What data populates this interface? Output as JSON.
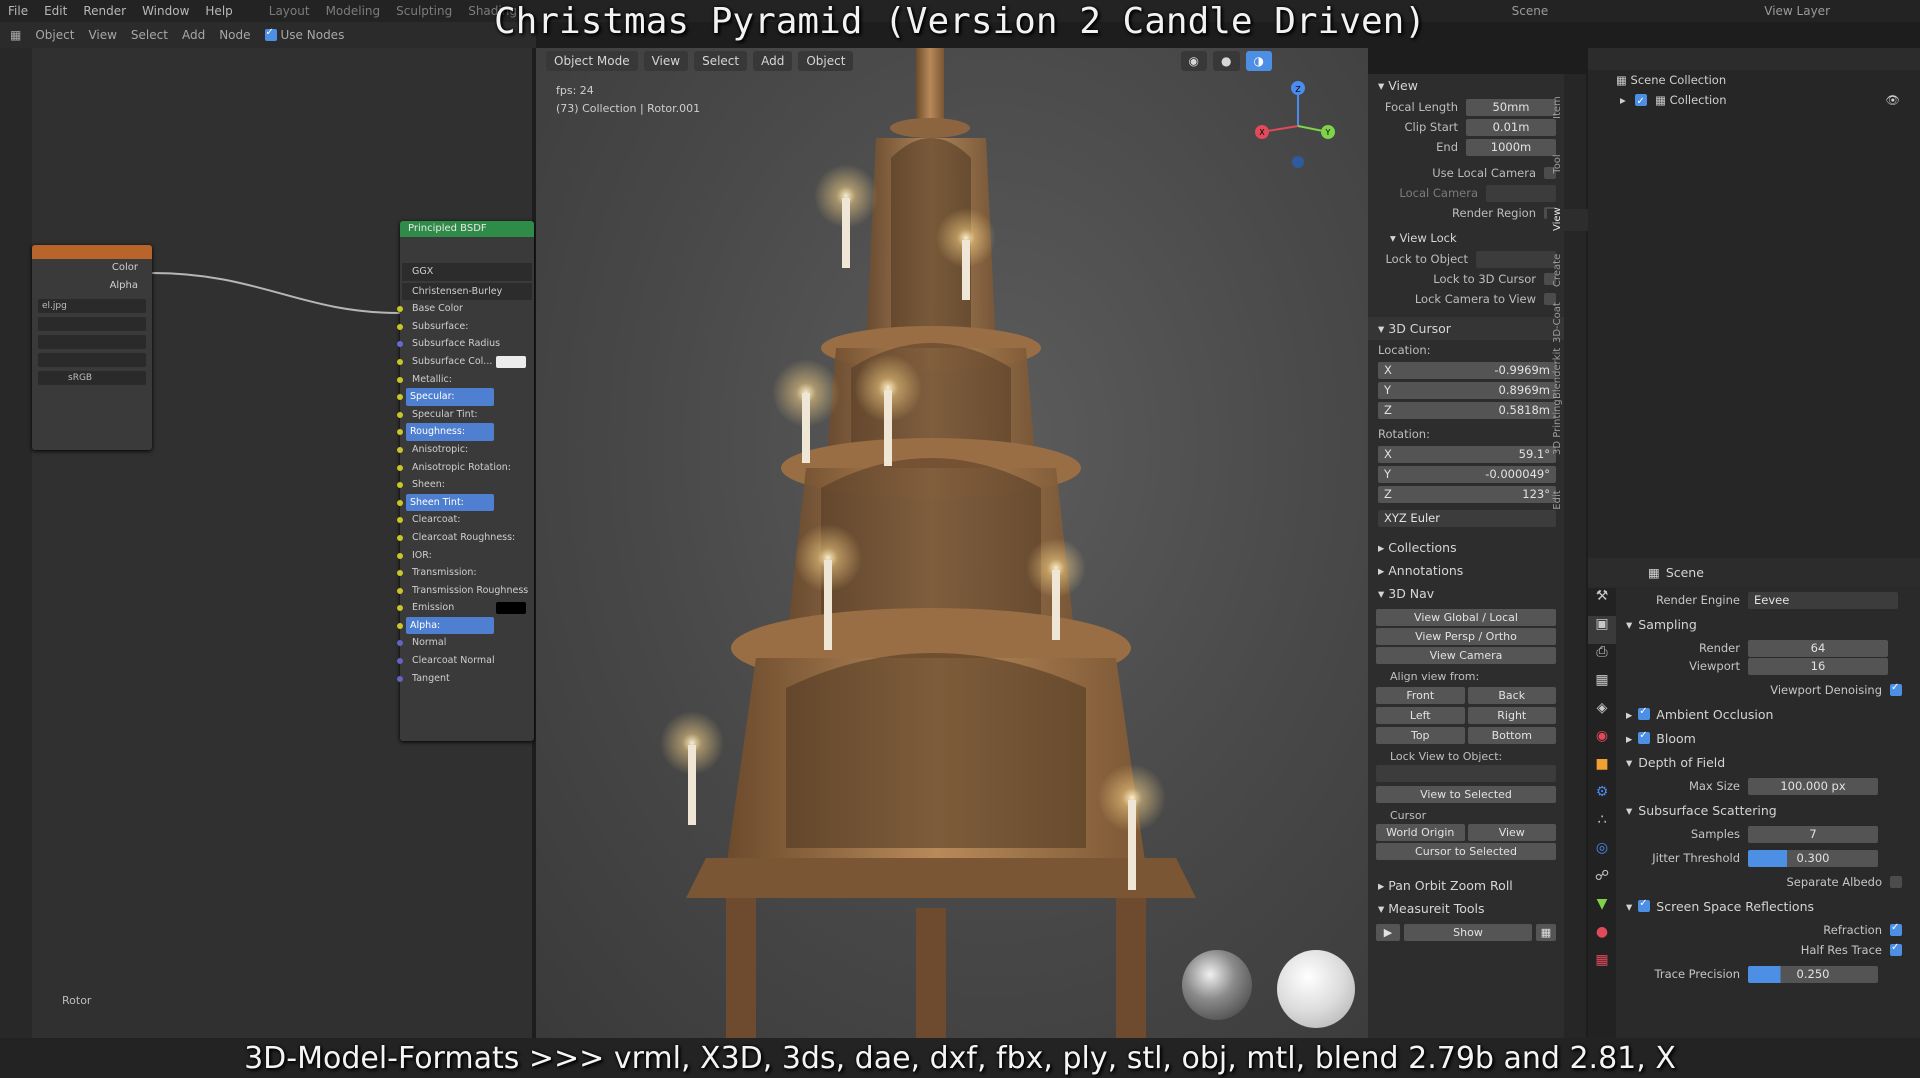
{
  "overlay": {
    "title": "Christmas Pyramid (Version 2 Candle Driven)",
    "footer": "3D-Model-Formats >>> vrml, X3D, 3ds, dae, dxf, fbx, ply, stl, obj, mtl, blend 2.79b and 2.81, X"
  },
  "menubar": {
    "items": [
      "File",
      "Edit",
      "Render",
      "Window",
      "Help"
    ],
    "workspaces": [
      "Layout",
      "Modeling",
      "Sculpting",
      "Shading"
    ],
    "scene": "Scene",
    "view_layer": "View Layer"
  },
  "node_editor": {
    "header": [
      "Object",
      "View",
      "Select",
      "Add",
      "Node",
      "Use Nodes"
    ],
    "texture_node": {
      "outputs": [
        "Color",
        "Alpha"
      ],
      "image": "el.jpg",
      "colorspace": "sRGB"
    },
    "bsdf": {
      "title": "Principled BSDF",
      "distribution": "GGX",
      "subsurface_method": "Christensen-Burley",
      "inputs": [
        "Base Color",
        "Subsurface:",
        "Subsurface Radius",
        "Subsurface Col...",
        "Metallic:",
        "Specular:",
        "Specular Tint:",
        "Roughness:",
        "Anisotropic:",
        "Anisotropic Rotation:",
        "Sheen:",
        "Sheen Tint:",
        "Clearcoat:",
        "Clearcoat Roughness:",
        "IOR:",
        "Transmission:",
        "Transmission Roughness",
        "Emission",
        "Alpha:",
        "Normal",
        "Clearcoat Normal",
        "Tangent"
      ],
      "highlighted": [
        "Specular:",
        "Roughness:",
        "Sheen Tint:",
        "Alpha:"
      ]
    },
    "frame_label": "Rotor"
  },
  "viewport": {
    "header": [
      "Object Mode",
      "View",
      "Select",
      "Add",
      "Object"
    ],
    "fps": "fps: 24",
    "info": "(73) Collection | Rotor.001",
    "gizmo": {
      "x": "X",
      "y": "Y",
      "z": "Z"
    }
  },
  "npanel": {
    "tabs": [
      "Item",
      "Tool",
      "View",
      "Create",
      "3D-Coat",
      "Blenderkit",
      "3D Printing",
      "Edit"
    ],
    "view": {
      "title": "View",
      "focal_length_label": "Focal Length",
      "focal_length": "50mm",
      "clip_start_label": "Clip Start",
      "clip_start": "0.01m",
      "end_label": "End",
      "end": "1000m",
      "use_local_camera": "Use Local Camera",
      "local_camera": "Local Camera",
      "render_region": "Render Region",
      "view_lock": "View Lock",
      "lock_to_object": "Lock to Object",
      "lock_3d_cursor": "Lock to 3D Cursor",
      "lock_camera": "Lock Camera to View"
    },
    "cursor": {
      "title": "3D Cursor",
      "location": "Location:",
      "loc": [
        [
          "X",
          "-0.9969m"
        ],
        [
          "Y",
          "0.8969m"
        ],
        [
          "Z",
          "0.5818m"
        ]
      ],
      "rotation": "Rotation:",
      "rot": [
        [
          "X",
          "59.1°"
        ],
        [
          "Y",
          "-0.000049°"
        ],
        [
          "Z",
          "123°"
        ]
      ],
      "mode": "XYZ Euler"
    },
    "collapsed": [
      "Collections",
      "Annotations"
    ],
    "nav": {
      "title": "3D Nav",
      "global_local": "View Global / Local",
      "persp_ortho": "View Persp / Ortho",
      "camera": "View Camera",
      "align": "Align view from:",
      "dirs": [
        "Front",
        "Back",
        "Left",
        "Right",
        "Top",
        "Bottom"
      ],
      "lock_view": "Lock View to Object:",
      "to_selected": "View to Selected",
      "cursor": "Cursor",
      "world_origin": "World Origin",
      "view": "View",
      "cursor_to_selected": "Cursor to Selected"
    },
    "pan_orbit": "Pan Orbit Zoom Roll",
    "measureit": "Measureit Tools",
    "show": "Show"
  },
  "outliner": {
    "scene_collection": "Scene Collection",
    "collection": "Collection"
  },
  "properties": {
    "scene": "Scene",
    "render_engine_label": "Render Engine",
    "render_engine": "Eevee",
    "sampling": "Sampling",
    "render_label": "Render",
    "render": "64",
    "viewport_label": "Viewport",
    "viewport": "16",
    "viewport_denoising": "Viewport Denoising",
    "ao": "Ambient Occlusion",
    "bloom": "Bloom",
    "dof": "Depth of Field",
    "max_size_label": "Max Size",
    "max_size": "100.000 px",
    "sss": "Subsurface Scattering",
    "samples_label": "Samples",
    "samples": "7",
    "jitter_label": "Jitter Threshold",
    "jitter": "0.300",
    "sep_albedo": "Separate Albedo",
    "ssr": "Screen Space Reflections",
    "refraction": "Refraction",
    "half_res": "Half Res Trace",
    "trace_label": "Trace Precision",
    "trace": "0.250"
  },
  "colors": {
    "accent": "#4d8fe4",
    "bsdf_header": "#2f8b48",
    "texture_header": "#b8642a"
  }
}
